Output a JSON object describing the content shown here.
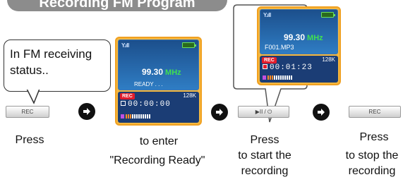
{
  "title": "Recording FM Program",
  "bubble_text": "In FM receiving status..",
  "steps": [
    {
      "button_label": "REC",
      "caption": "Press"
    },
    {
      "caption_line1": "to enter",
      "caption_line2": "\"Recording Ready\""
    },
    {
      "caption_line1": "Press",
      "caption_line2": "to start the",
      "caption_line3": "recording",
      "button_label": "▶II / ⏻"
    },
    {
      "button_label": "REC",
      "caption_line1": "Press",
      "caption_line2": "to stop the",
      "caption_line3": "recording"
    }
  ],
  "screen_ready": {
    "signal": "Y.ıll",
    "frequency": "99.30",
    "unit": "MHz",
    "status": "READY . . .",
    "rec": "REC",
    "bitrate": "128K",
    "timer": "00:00:00"
  },
  "screen_recording": {
    "signal": "Y.ıll",
    "frequency": "99.30",
    "unit": "MHz",
    "file": "F001.MP3",
    "rec": "REC",
    "bitrate": "128K",
    "timer": "00:01:23"
  },
  "colors": {
    "accent_orange": "#f0a020",
    "rec_red": "#e21c2b",
    "screen_blue": "#1c4f8c",
    "mhz_green": "#40e050"
  },
  "icons": {
    "arrow": "right-arrow-icon"
  }
}
